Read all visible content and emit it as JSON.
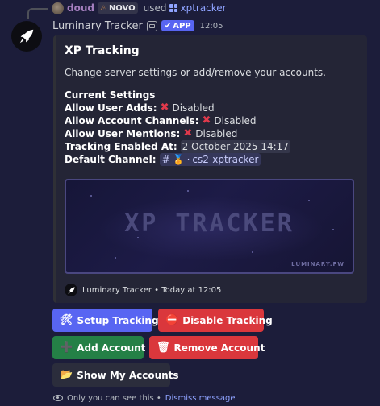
{
  "reply": {
    "username": "doud",
    "tag": "NOVO",
    "used_text": "used",
    "command": "xptracker"
  },
  "message": {
    "bot_name": "Luminary Tracker",
    "app_badge": "APP",
    "timestamp": "12:05"
  },
  "embed": {
    "title": "XP Tracking",
    "description": "Change server settings or add/remove your accounts.",
    "settings_heading": "Current Settings",
    "settings": [
      {
        "label": "Allow User Adds:",
        "value": "Disabled"
      },
      {
        "label": "Allow Account Channels:",
        "value": "Disabled"
      },
      {
        "label": "Allow User Mentions:",
        "value": "Disabled"
      },
      {
        "label": "Tracking Enabled At:",
        "value": "2 October 2025 14:17"
      },
      {
        "label": "Default Channel:",
        "value": "cs2-xptracker"
      }
    ],
    "banner_title": "XP TRACKER",
    "banner_subtitle": "LUMINARY.FW",
    "footer": "Luminary Tracker • Today at 12:05"
  },
  "buttons": {
    "setup": "Setup Tracking",
    "disable": "Disable Tracking",
    "add": "Add Account",
    "remove": "Remove Account",
    "show": "Show My Accounts"
  },
  "ephemeral": {
    "notice": "Only you can see this •",
    "dismiss": "Dismiss message"
  },
  "colors": {
    "background": "#1c1d3a",
    "embed_bg": "#242536",
    "primary": "#5865f2",
    "danger": "#da373c",
    "success": "#248046",
    "link": "#8fa3ff"
  }
}
